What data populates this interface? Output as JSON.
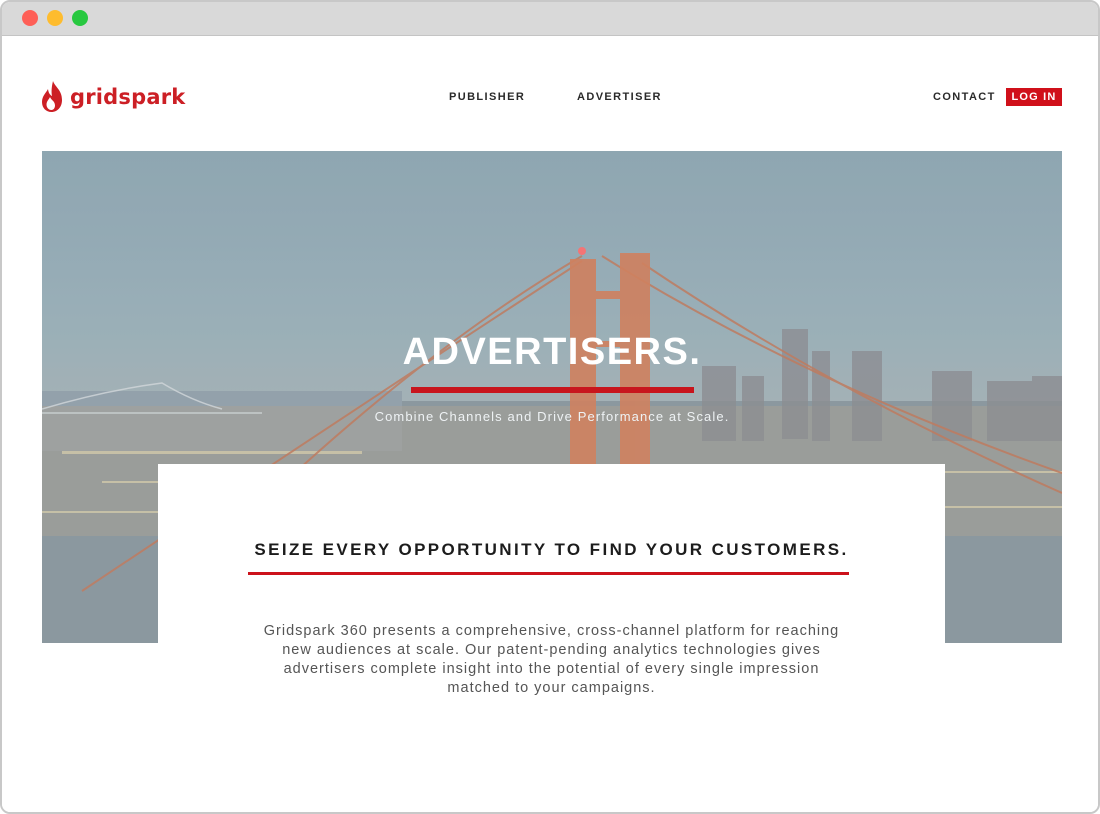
{
  "brand": {
    "name": "gridspark",
    "accent": "#d0101a"
  },
  "nav": {
    "left": [
      {
        "label": "PUBLISHER"
      },
      {
        "label": "ADVERTISER"
      }
    ],
    "contact_label": "CONTACT",
    "login_label": "LOG IN"
  },
  "hero": {
    "title": "ADVERTISERS.",
    "subtitle": "Combine Channels and Drive Performance at Scale.",
    "image_description_icon": "golden-gate-bridge-photo"
  },
  "section": {
    "heading": "SEIZE EVERY OPPORTUNITY TO FIND YOUR CUSTOMERS.",
    "body": "Gridspark 360 presents a comprehensive, cross-channel platform for reaching new audiences at scale. Our patent-pending analytics technologies gives advertisers complete insight into the potential of every single impression matched to your campaigns."
  },
  "window": {
    "controls": [
      "close-icon",
      "minimize-icon",
      "maximize-icon"
    ]
  }
}
